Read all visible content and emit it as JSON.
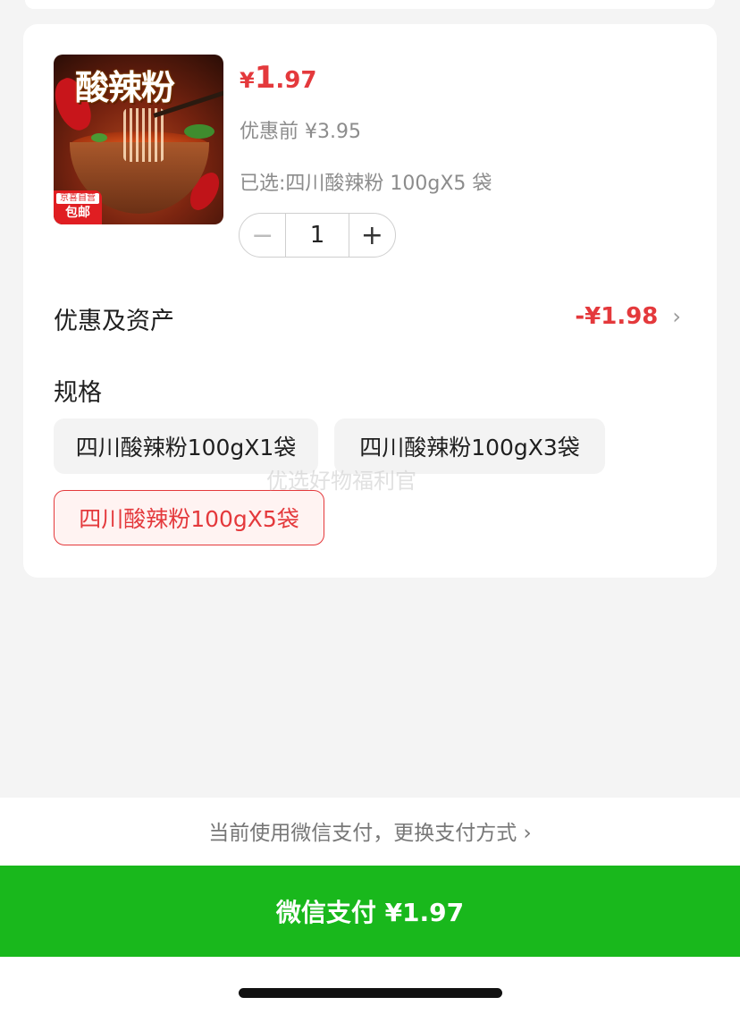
{
  "product": {
    "image_title": "酸辣粉",
    "badge_top": "京喜自营",
    "badge_bottom": "包邮",
    "price_currency": "¥",
    "price_integer": "1",
    "price_decimal": ".97",
    "original_price": "优惠前 ¥3.95",
    "selected_text": "已选:四川酸辣粉 100gX5 袋",
    "quantity": "1",
    "minus_symbol": "−",
    "plus_symbol": "+"
  },
  "discount": {
    "label": "优惠及资产",
    "amount": "-¥1.98",
    "chevron": "›"
  },
  "spec": {
    "label": "规格",
    "options": [
      {
        "label": "四川酸辣粉100gX1袋",
        "selected": false
      },
      {
        "label": "四川酸辣粉100gX3袋",
        "selected": false
      },
      {
        "label": "四川酸辣粉100gX5袋",
        "selected": true
      }
    ]
  },
  "watermark": "优选好物福利官",
  "payment": {
    "tip": "当前使用微信支付，更换支付方式 ›",
    "button_label": "微信支付 ¥1.97",
    "button_color": "#19b81c",
    "accent_color": "#e4393c"
  }
}
